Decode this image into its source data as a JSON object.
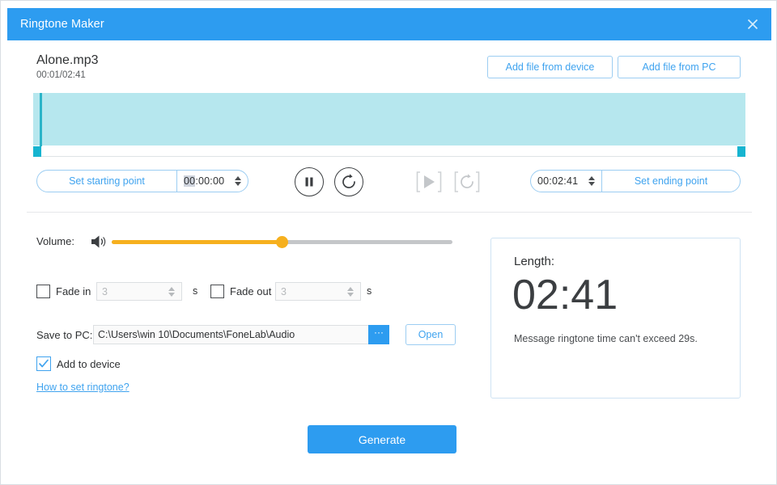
{
  "window": {
    "title": "Ringtone Maker",
    "close_icon": "close-icon"
  },
  "header": {
    "file_name": "Alone.mp3",
    "file_time": "00:01/02:41",
    "add_from_device_label": "Add file from device",
    "add_from_pc_label": "Add file from PC"
  },
  "waveform": {
    "region_color": "#b6e7ee",
    "handle_color": "#16b4d0",
    "playhead_color": "#2bb4c8"
  },
  "transport": {
    "set_starting_point_label": "Set starting point",
    "start_time_selected": "00",
    "start_time_rest": ":00:00",
    "end_time": "00:02:41",
    "set_ending_point_label": "Set ending point",
    "pause_icon": "pause-icon",
    "replay_icon": "replay-icon",
    "play_icon_disabled": "play-icon",
    "repeat_icon_disabled": "repeat-icon"
  },
  "volume": {
    "label": "Volume:",
    "icon": "speaker-icon",
    "value_percent": 50,
    "accent_color": "#f6b01e"
  },
  "fade": {
    "fade_in_label": "Fade in",
    "fade_in_value": "3",
    "fade_in_checked": false,
    "fade_out_label": "Fade out",
    "fade_out_value": "3",
    "fade_out_checked": false,
    "unit_1": "s",
    "unit_2": "s"
  },
  "save": {
    "label": "Save to PC:",
    "path": "C:\\Users\\win 10\\Documents\\FoneLab\\Audio",
    "browse_label": "···",
    "open_label": "Open",
    "add_to_device_label": "Add to device",
    "add_to_device_checked": true,
    "how_to_link": "How to set ringtone?"
  },
  "length": {
    "title": "Length:",
    "value": "02:41",
    "note": "Message ringtone time can't exceed 29s."
  },
  "footer": {
    "generate_label": "Generate"
  }
}
